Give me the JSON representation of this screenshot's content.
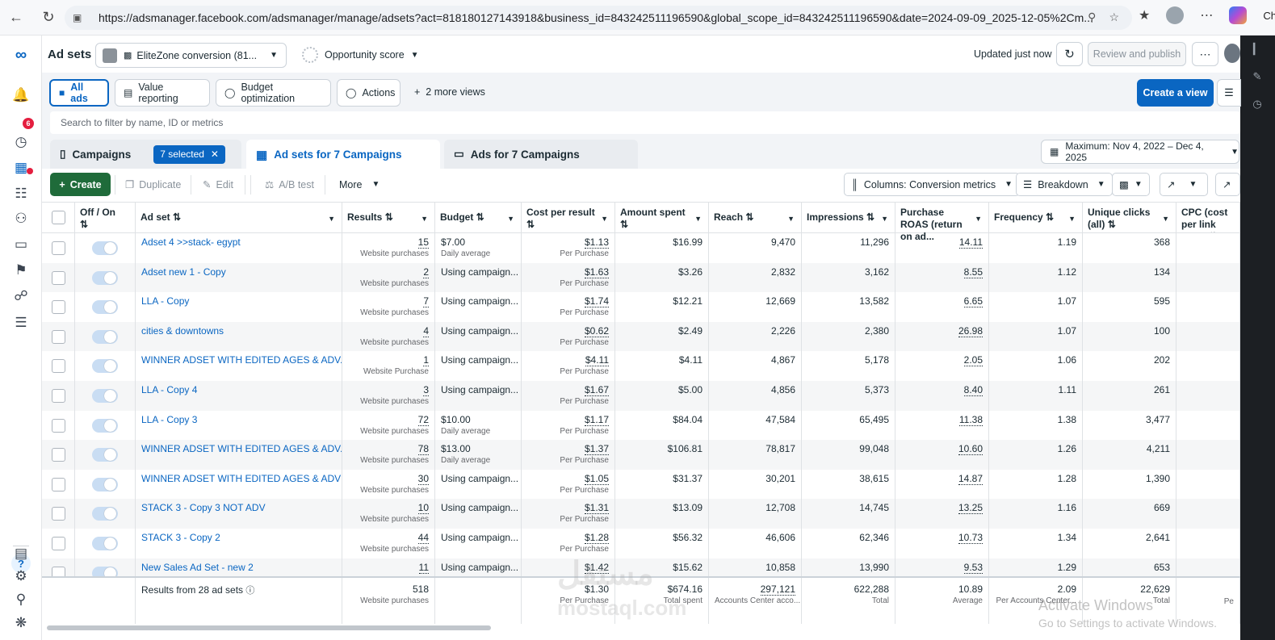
{
  "browser": {
    "url": "https://adsmanager.facebook.com/adsmanager/manage/adsets?act=818180127143918&business_id=843242511196590&global_scope_id=843242511196590&date=2024-09-09_2025-12-05%2Cm...",
    "profile_label": "Cha"
  },
  "header": {
    "title": "Ad sets",
    "account": "EliteZone conversion (81...",
    "opportunity": "Opportunity score",
    "updated": "Updated just now",
    "review_publish": "Review and publish",
    "notification_count": "6"
  },
  "views": {
    "all_ads": "All ads",
    "value_reporting": "Value reporting",
    "budget_optimization": "Budget optimization",
    "actions": "Actions",
    "more_views": "2 more views",
    "create_view": "Create a view"
  },
  "search": {
    "placeholder": "Search to filter by name, ID or metrics"
  },
  "tabs": {
    "campaigns": "Campaigns",
    "selected": "7 selected",
    "adsets": "Ad sets for 7 Campaigns",
    "ads": "Ads for 7 Campaigns"
  },
  "date_range": "Maximum: Nov 4, 2022 – Dec 4, 2025",
  "toolbar": {
    "create": "Create",
    "duplicate": "Duplicate",
    "edit": "Edit",
    "ab_test": "A/B test",
    "more": "More",
    "columns": "Columns: Conversion metrics",
    "breakdown": "Breakdown"
  },
  "columns": {
    "offon": "Off / On",
    "adset": "Ad set",
    "results": "Results",
    "budget": "Budget",
    "cpr": "Cost per result",
    "spent": "Amount spent",
    "reach": "Reach",
    "impressions": "Impressions",
    "roas": "Purchase ROAS (return on ad...",
    "frequency": "Frequency",
    "unique_clicks": "Unique clicks (all)",
    "cpc": "CPC (cost per link click)"
  },
  "rows": [
    {
      "name": "Adset 4 >>stack- egypt",
      "results": "15",
      "results_sub": "Website purchases",
      "budget": "$7.00",
      "budget_sub": "Daily average",
      "cpr": "$1.13",
      "cpr_sub": "Per Purchase",
      "spent": "$16.99",
      "reach": "9,470",
      "impr": "11,296",
      "roas": "14.11",
      "freq": "1.19",
      "uc": "368"
    },
    {
      "name": "Adset new 1 - Copy",
      "results": "2",
      "results_sub": "Website purchases",
      "budget": "Using campaign...",
      "budget_sub": "",
      "cpr": "$1.63",
      "cpr_sub": "Per Purchase",
      "spent": "$3.26",
      "reach": "2,832",
      "impr": "3,162",
      "roas": "8.55",
      "freq": "1.12",
      "uc": "134"
    },
    {
      "name": "LLA - Copy",
      "results": "7",
      "results_sub": "Website purchases",
      "budget": "Using campaign...",
      "budget_sub": "",
      "cpr": "$1.74",
      "cpr_sub": "Per Purchase",
      "spent": "$12.21",
      "reach": "12,669",
      "impr": "13,582",
      "roas": "6.65",
      "freq": "1.07",
      "uc": "595"
    },
    {
      "name": "cities & downtowns",
      "results": "4",
      "results_sub": "Website purchases",
      "budget": "Using campaign...",
      "budget_sub": "",
      "cpr": "$0.62",
      "cpr_sub": "Per Purchase",
      "spent": "$2.49",
      "reach": "2,226",
      "impr": "2,380",
      "roas": "26.98",
      "freq": "1.07",
      "uc": "100"
    },
    {
      "name": "WINNER ADSET WITH EDITED AGES & ADV...",
      "results": "1",
      "results_sub": "Website Purchase",
      "budget": "Using campaign...",
      "budget_sub": "",
      "cpr": "$4.11",
      "cpr_sub": "Per Purchase",
      "spent": "$4.11",
      "reach": "4,867",
      "impr": "5,178",
      "roas": "2.05",
      "freq": "1.06",
      "uc": "202"
    },
    {
      "name": "LLA - Copy 4",
      "results": "3",
      "results_sub": "Website purchases",
      "budget": "Using campaign...",
      "budget_sub": "",
      "cpr": "$1.67",
      "cpr_sub": "Per Purchase",
      "spent": "$5.00",
      "reach": "4,856",
      "impr": "5,373",
      "roas": "8.40",
      "freq": "1.11",
      "uc": "261"
    },
    {
      "name": "LLA - Copy 3",
      "results": "72",
      "results_sub": "Website purchases",
      "budget": "$10.00",
      "budget_sub": "Daily average",
      "cpr": "$1.17",
      "cpr_sub": "Per Purchase",
      "spent": "$84.04",
      "reach": "47,584",
      "impr": "65,495",
      "roas": "11.38",
      "freq": "1.38",
      "uc": "3,477"
    },
    {
      "name": "WINNER ADSET WITH EDITED AGES & ADV...",
      "results": "78",
      "results_sub": "Website purchases",
      "budget": "$13.00",
      "budget_sub": "Daily average",
      "cpr": "$1.37",
      "cpr_sub": "Per Purchase",
      "spent": "$106.81",
      "reach": "78,817",
      "impr": "99,048",
      "roas": "10.60",
      "freq": "1.26",
      "uc": "4,211"
    },
    {
      "name": "WINNER ADSET WITH EDITED AGES & ADV",
      "results": "30",
      "results_sub": "Website purchases",
      "budget": "Using campaign...",
      "budget_sub": "",
      "cpr": "$1.05",
      "cpr_sub": "Per Purchase",
      "spent": "$31.37",
      "reach": "30,201",
      "impr": "38,615",
      "roas": "14.87",
      "freq": "1.28",
      "uc": "1,390"
    },
    {
      "name": "STACK 3 - Copy 3 NOT ADV",
      "results": "10",
      "results_sub": "Website purchases",
      "budget": "Using campaign...",
      "budget_sub": "",
      "cpr": "$1.31",
      "cpr_sub": "Per Purchase",
      "spent": "$13.09",
      "reach": "12,708",
      "impr": "14,745",
      "roas": "13.25",
      "freq": "1.16",
      "uc": "669"
    },
    {
      "name": "STACK 3 - Copy 2",
      "results": "44",
      "results_sub": "Website purchases",
      "budget": "Using campaign...",
      "budget_sub": "",
      "cpr": "$1.28",
      "cpr_sub": "Per Purchase",
      "spent": "$56.32",
      "reach": "46,606",
      "impr": "62,346",
      "roas": "10.73",
      "freq": "1.34",
      "uc": "2,641"
    },
    {
      "name": "New Sales Ad Set - new 2",
      "results": "11",
      "results_sub": "",
      "budget": "Using campaign...",
      "budget_sub": "",
      "cpr": "$1.42",
      "cpr_sub": "",
      "spent": "$15.62",
      "reach": "10,858",
      "impr": "13,990",
      "roas": "9.53",
      "freq": "1.29",
      "uc": "653"
    }
  ],
  "footer": {
    "label": "Results from 28 ad sets",
    "results": "518",
    "results_sub": "Website purchases",
    "cpr": "$1.30",
    "cpr_sub": "Per Purchase",
    "spent": "$674.16",
    "spent_sub": "Total spent",
    "reach": "297,121",
    "reach_sub": "Accounts Center acco...",
    "impr": "622,288",
    "impr_sub": "Total",
    "roas": "10.89",
    "roas_sub": "Average",
    "freq": "2.09",
    "freq_sub": "Per Accounts Center...",
    "uc": "22,629",
    "uc_sub": "Total",
    "cpc_sub": "Pe"
  },
  "watermark": {
    "line1": "Activate Windows",
    "line2": "Go to Settings to activate Windows.",
    "brand": "مستقل",
    "brand2": "mostaql.com"
  }
}
